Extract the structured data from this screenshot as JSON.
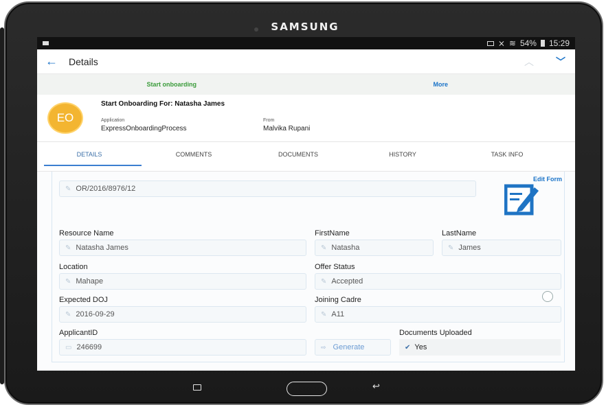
{
  "device": {
    "brand": "SAMSUNG"
  },
  "status_bar": {
    "battery": "54%",
    "time": "15:29"
  },
  "app_bar": {
    "back_icon": "←",
    "title": "Details",
    "up_icon": "︿",
    "down_icon": "﹀"
  },
  "actions": {
    "start": "Start onboarding",
    "more": "More"
  },
  "task": {
    "avatar_initials": "EO",
    "title": "Start Onboarding For: Natasha James",
    "application_label": "Application",
    "application_value": "ExpressOnboardingProcess",
    "from_label": "From",
    "from_value": "Malvika Rupani"
  },
  "tabs": [
    {
      "label": "DETAILS"
    },
    {
      "label": "COMMENTS"
    },
    {
      "label": "DOCUMENTS"
    },
    {
      "label": "HISTORY"
    },
    {
      "label": "TASK INFO"
    }
  ],
  "form": {
    "edit_form_label": "Edit Form",
    "reference": "OR/2016/8976/12",
    "resource_name": {
      "label": "Resource Name",
      "value": "Natasha James"
    },
    "first_name": {
      "label": "FirstName",
      "value": "Natasha"
    },
    "last_name": {
      "label": "LastName",
      "value": "James"
    },
    "location": {
      "label": "Location",
      "value": "Mahape"
    },
    "offer_status": {
      "label": "Offer Status",
      "value": "Accepted"
    },
    "expected_doj": {
      "label": "Expected DOJ",
      "value": "2016-09-29"
    },
    "joining_cadre": {
      "label": "Joining Cadre",
      "value": "A11"
    },
    "applicant_id": {
      "label": "ApplicantID",
      "value": "246699"
    },
    "generate_label": "Generate",
    "documents_uploaded": {
      "label": "Documents Uploaded",
      "value": "Yes"
    }
  },
  "colors": {
    "accent": "#1a73c8",
    "start_green": "#3a9b3a",
    "avatar": "#f3b531"
  }
}
